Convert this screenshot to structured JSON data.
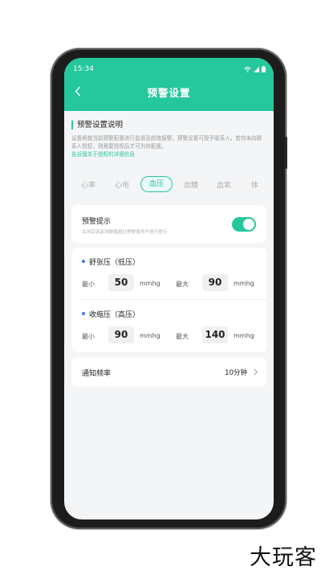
{
  "status": {
    "time": "15:34"
  },
  "header": {
    "title": "预警设置"
  },
  "intro": {
    "title": "预警设置说明",
    "text": "设备将按当前预警配置进行监测及超值报警。预警设置可授予联系人。若你未向联系人授权，则需要授权后才可为你配置。",
    "link": "告诉我关于授权的详细信息"
  },
  "tabs": [
    {
      "label": "心率"
    },
    {
      "label": "心电"
    },
    {
      "label": "血压"
    },
    {
      "label": "血糖"
    },
    {
      "label": "血氧"
    },
    {
      "label": "体"
    }
  ],
  "active_tab": "血压",
  "alert": {
    "label": "预警提示",
    "desc": "关闭后该监测数值超过预警值将不进行提示",
    "enabled": true
  },
  "diastolic": {
    "title": "舒张压（低压）",
    "min_label": "最小",
    "min": "50",
    "max_label": "最大",
    "max": "90",
    "unit": "mmhg"
  },
  "systolic": {
    "title": "收缩压（高压）",
    "min_label": "最小",
    "min": "90",
    "max_label": "最大",
    "max": "140",
    "unit": "mmhg"
  },
  "frequency": {
    "label": "通知频率",
    "value": "10分钟"
  },
  "brand": "大玩客",
  "colors": {
    "accent": "#25c79d",
    "bullet": "#3d7cf5"
  }
}
